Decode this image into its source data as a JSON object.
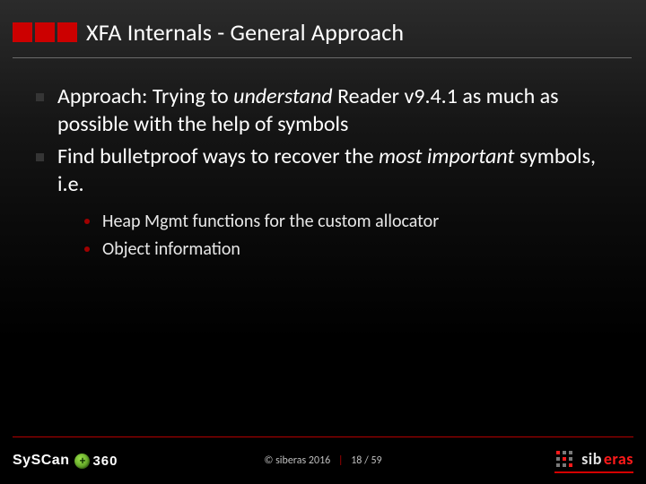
{
  "title": "XFA Internals - General Approach",
  "bullets": {
    "b1_prefix": "Approach: Trying to ",
    "b1_ital": "understand",
    "b1_suffix": " Reader v9.4.1 as much as possible with the help of symbols",
    "b2_prefix": "Find bulletproof ways to recover the ",
    "b2_ital": "most important",
    "b2_suffix": " symbols, i.e.",
    "sub1": "Heap Mgmt functions for the custom allocator",
    "sub2": "Object information"
  },
  "footer": {
    "copyright": "© siberas 2016",
    "sep": "|",
    "page_current": "18",
    "page_sep": "/",
    "page_total": "59"
  },
  "logos": {
    "syscan": "SySCan",
    "n360": "360",
    "sib": "sib",
    "eras": "eras"
  }
}
